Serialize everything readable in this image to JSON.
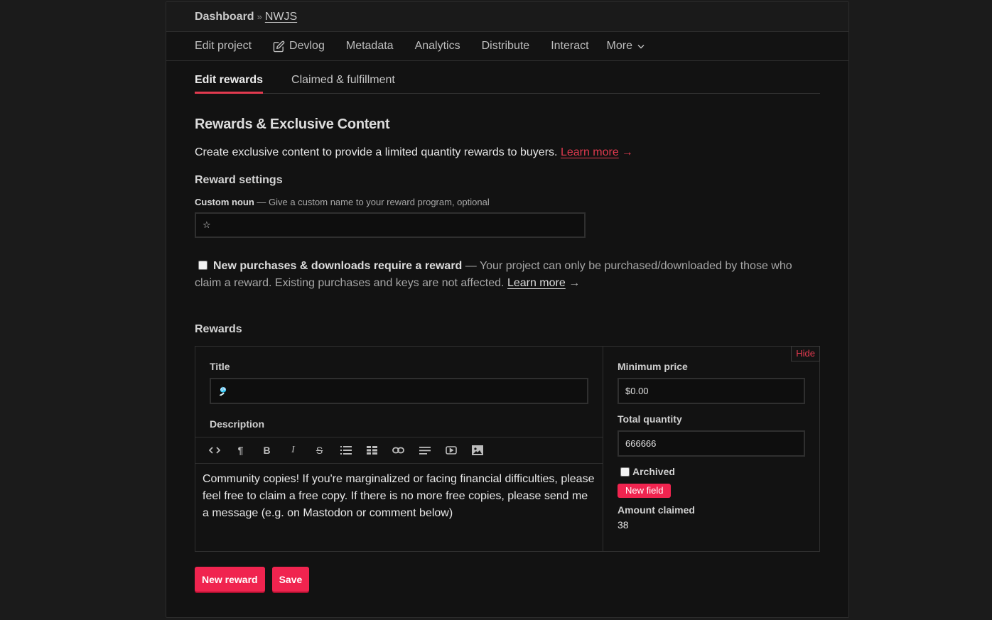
{
  "breadcrumb": {
    "root": "Dashboard",
    "separator": "»",
    "current": "NWJS"
  },
  "nav": {
    "items": [
      {
        "label": "Edit project",
        "icon": null
      },
      {
        "label": "Devlog",
        "icon": "edit-square-icon"
      },
      {
        "label": "Metadata",
        "icon": null
      },
      {
        "label": "Analytics",
        "icon": null
      },
      {
        "label": "Distribute",
        "icon": null
      },
      {
        "label": "Interact",
        "icon": null
      },
      {
        "label": "More",
        "icon": "chevron-down-icon"
      }
    ]
  },
  "tabs": [
    {
      "label": "Edit rewards",
      "active": true
    },
    {
      "label": "Claimed & fulfillment",
      "active": false
    }
  ],
  "heading": "Rewards & Exclusive Content",
  "intro": {
    "text": "Create exclusive content to provide a limited quantity rewards to buyers.",
    "link": "Learn more",
    "arrow": "→"
  },
  "reward_settings": {
    "heading": "Reward settings",
    "custom_noun": {
      "label": "Custom noun",
      "hint": "— Give a custom name to your reward program, optional",
      "value": "☆"
    },
    "require_reward": {
      "checked": false,
      "label": "New purchases & downloads require a reward",
      "description": "— Your project can only be purchased/downloaded by those who claim a reward. Existing purchases and keys are not affected.",
      "link": "Learn more",
      "arrow": "→"
    }
  },
  "rewards": {
    "heading": "Rewards",
    "hide_label": "Hide",
    "items": [
      {
        "title_label": "Title",
        "title_value": "🎐",
        "description_label": "Description",
        "toolbar": [
          {
            "name": "code-view-icon",
            "glyph": "<>"
          },
          {
            "name": "paragraph-icon",
            "glyph": "¶"
          },
          {
            "name": "bold-icon",
            "glyph": "B"
          },
          {
            "name": "italic-icon",
            "glyph": "I"
          },
          {
            "name": "strikethrough-icon",
            "glyph": "S"
          },
          {
            "name": "bulleted-list-icon",
            "glyph": ""
          },
          {
            "name": "table-icon",
            "glyph": ""
          },
          {
            "name": "link-icon",
            "glyph": ""
          },
          {
            "name": "align-icon",
            "glyph": ""
          },
          {
            "name": "video-icon",
            "glyph": ""
          },
          {
            "name": "image-icon",
            "glyph": ""
          }
        ],
        "description": "Community copies! If you're marginalized or facing financial difficulties, please feel free to claim a free copy. If there is no more free copies, please send me a message (e.g. on Mastodon or comment below)",
        "min_price_label": "Minimum price",
        "min_price_value": "$0.00",
        "quantity_label": "Total quantity",
        "quantity_value": "666666",
        "archived_label": "Archived",
        "archived": false,
        "new_field_label": "New field",
        "amount_claimed_label": "Amount claimed",
        "amount_claimed_value": "38"
      }
    ]
  },
  "actions": {
    "new_reward": "New reward",
    "save": "Save"
  },
  "colors": {
    "accent": "#f0244f",
    "link_red": "#e23a4f",
    "page_bg": "#121212",
    "outer_bg": "#1b1b1b"
  }
}
